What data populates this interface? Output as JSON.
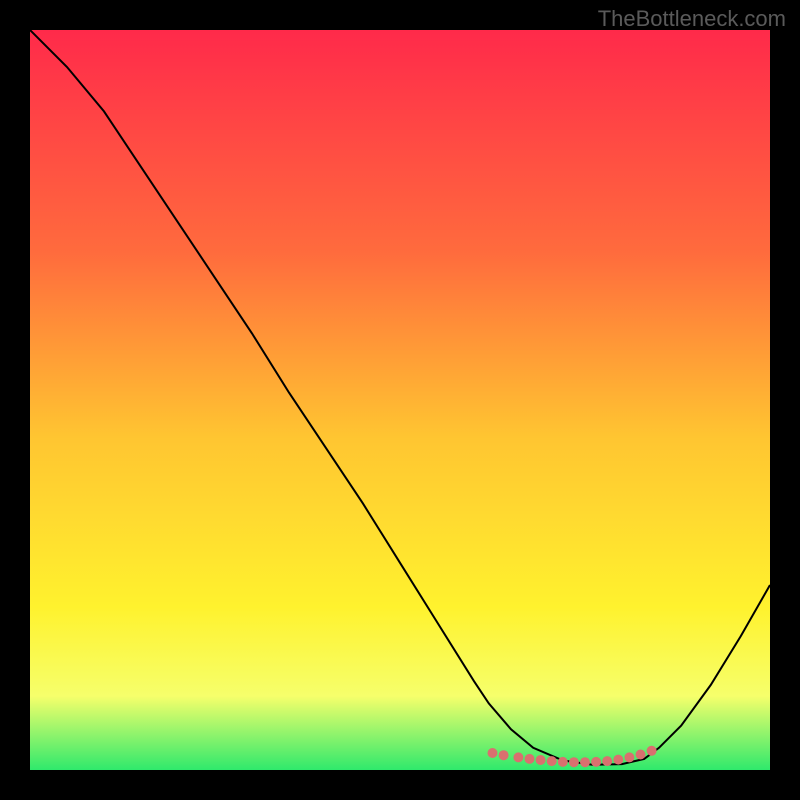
{
  "watermark": "TheBottleneck.com",
  "chart_data": {
    "type": "line",
    "title": "",
    "xlabel": "",
    "ylabel": "",
    "xlim": [
      0,
      100
    ],
    "ylim": [
      0,
      100
    ],
    "gradient": {
      "top": "#ff2a4a",
      "upper_mid": "#ff6b3d",
      "mid": "#ffc531",
      "lower_mid": "#fff22e",
      "low": "#f6ff6b",
      "bottom": "#2fe96c"
    },
    "series": [
      {
        "name": "bottleneck-curve",
        "x": [
          0,
          5,
          10,
          15,
          20,
          25,
          30,
          35,
          40,
          45,
          50,
          55,
          60,
          62,
          65,
          68,
          72,
          76,
          80,
          83,
          85,
          88,
          92,
          96,
          100
        ],
        "y": [
          100,
          95,
          89,
          81.5,
          74,
          66.5,
          59,
          51,
          43.5,
          36,
          28,
          20,
          12,
          9,
          5.5,
          3,
          1.3,
          0.7,
          0.8,
          1.5,
          3,
          6,
          11.5,
          18,
          25
        ],
        "stroke": "#000000",
        "width": 2
      }
    ],
    "markers": {
      "name": "highlight-dots",
      "color": "#d9706f",
      "radius": 5,
      "points_x": [
        62.5,
        64,
        66,
        67.5,
        69,
        70.5,
        72,
        73.5,
        75,
        76.5,
        78,
        79.5,
        81,
        82.5,
        84
      ],
      "points_y": [
        2.3,
        2.0,
        1.7,
        1.5,
        1.35,
        1.2,
        1.1,
        1.05,
        1.05,
        1.1,
        1.2,
        1.4,
        1.7,
        2.1,
        2.6
      ]
    }
  }
}
